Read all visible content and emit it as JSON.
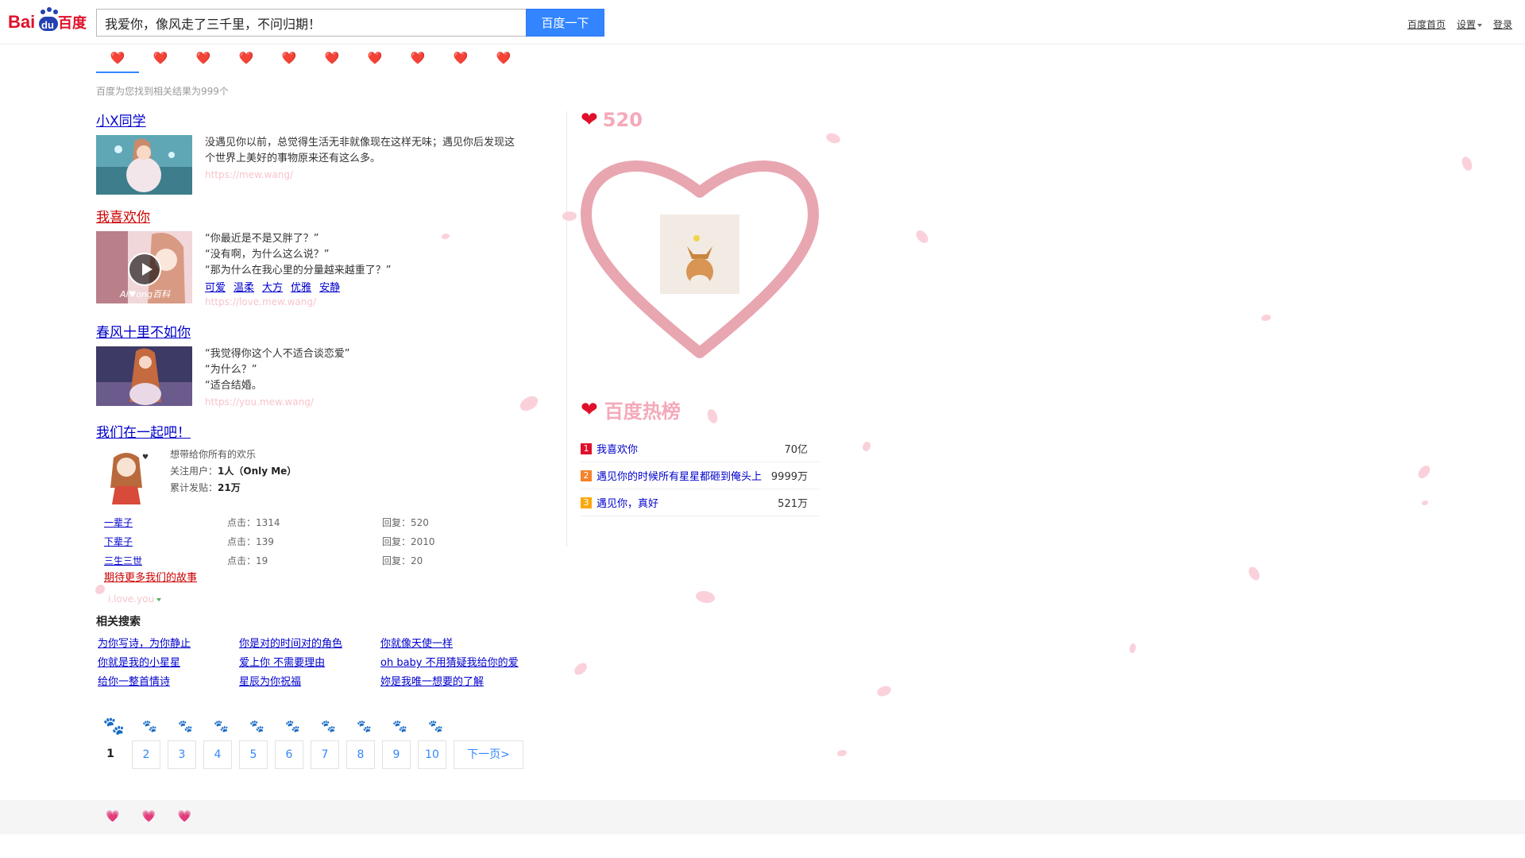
{
  "logo": {
    "text_left": "Bai",
    "text_mid": "du",
    "text_right": "百度"
  },
  "search": {
    "value": "我爱你，像风走了三千里，不问归期！",
    "button_label": "百度一下"
  },
  "top_links": {
    "home": "百度首页",
    "settings": "设置",
    "login": "登录"
  },
  "tabs": [
    "❤️",
    "❤️",
    "❤️",
    "❤️",
    "❤️",
    "❤️",
    "❤️",
    "❤️",
    "❤️",
    "❤️"
  ],
  "result_count": "百度为您找到相关结果为999个",
  "results": [
    {
      "title": "小X同学",
      "text": "没遇见你以前，总觉得生活无非就像现在这样无味；遇见你后发现这个世界上美好的事物原来还有这么多。",
      "url": "https://mew.wang/"
    },
    {
      "title": "我喜欢你",
      "lines": [
        "“你最近是不是又胖了？”",
        "“没有啊，为什么这么说？”",
        "“那为什么在我心里的分量越来越重了？”"
      ],
      "tags": [
        "可爱",
        "温柔",
        "大方",
        "优雅",
        "安静"
      ],
      "url": "https://love.mew.wang/",
      "thumb_caption": "Ai♥ong百科"
    },
    {
      "title": "春风十里不如你",
      "lines": [
        "“我觉得你这个人不适合谈恋爱”",
        "“为什么？”",
        "“适合结婚。"
      ],
      "url": "https://you.mew.wang/"
    }
  ],
  "forum": {
    "title": "我们在一起吧！",
    "desc": "想带给你所有的欢乐",
    "followers_label": "关注用户：",
    "followers_value": "1人（Only Me）",
    "posts_label": "累计发贴：",
    "posts_value": "21万",
    "rows": [
      {
        "name": "一辈子",
        "clicks": "点击：1314",
        "replies": "回复：520"
      },
      {
        "name": "下辈子",
        "clicks": "点击：139",
        "replies": "回复：2010"
      },
      {
        "name": "三生三世",
        "clicks": "点击：19",
        "replies": "回复：20"
      }
    ],
    "more": "期待更多我们的故事",
    "url": "i.love.you"
  },
  "related": {
    "title": "相关搜索",
    "items": [
      "为你写诗，为你静止",
      "你是对的时间对的角色",
      "你就像天使一样",
      "你就是我的小星星",
      "爱上你 不需要理由",
      "oh baby 不用猜疑我给你的爱",
      "给你一整首情诗",
      "星辰为你祝福",
      "妳是我唯一想要的了解"
    ]
  },
  "pager": {
    "current": "1",
    "pages": [
      "2",
      "3",
      "4",
      "5",
      "6",
      "7",
      "8",
      "9",
      "10"
    ],
    "next": "下一页>"
  },
  "right": {
    "score": "520",
    "hot_title": "百度热榜",
    "hot": [
      {
        "rank": "1",
        "name": "我喜欢你",
        "num": "70亿",
        "color": "#e0102a"
      },
      {
        "rank": "2",
        "name": "遇见你的时候所有星星都砸到俺头上",
        "num": "9999万",
        "color": "#f5822b"
      },
      {
        "rank": "3",
        "name": "遇见你，真好",
        "num": "521万",
        "color": "#faa90e"
      }
    ]
  },
  "colors": {
    "accent": "#3385ff",
    "link": "#0000cc",
    "heart": "#e0102a",
    "pink": "#f5a9b9"
  }
}
